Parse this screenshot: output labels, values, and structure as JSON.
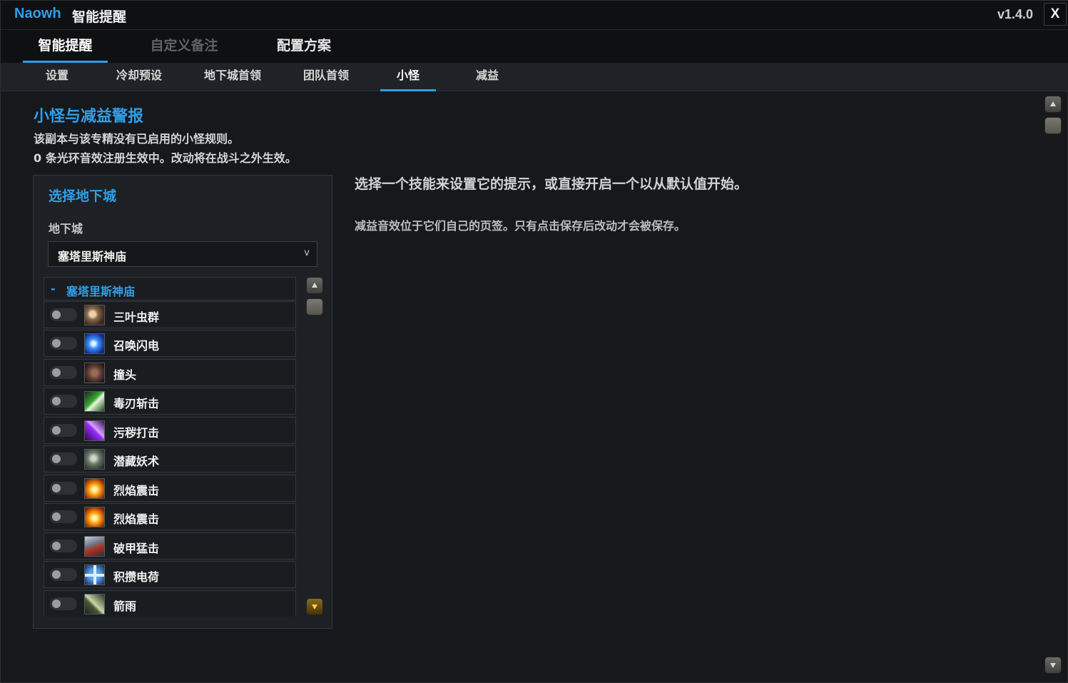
{
  "app": {
    "brand": "Naowh",
    "title": "智能提醒",
    "version": "v1.4.0",
    "close_label": "X"
  },
  "main_tabs": [
    {
      "label": "智能提醒",
      "state": "active"
    },
    {
      "label": "自定义备注",
      "state": "disabled"
    },
    {
      "label": "配置方案",
      "state": "normal"
    }
  ],
  "sub_tabs": [
    {
      "label": "设置"
    },
    {
      "label": "冷却预设"
    },
    {
      "label": "地下城首领"
    },
    {
      "label": "团队首领"
    },
    {
      "label": "小怪",
      "active": true
    },
    {
      "label": "减益"
    }
  ],
  "section": {
    "title": "小怪与减益警报",
    "desc1": "该副本与该专精没有已启用的小怪规则。",
    "desc2": "0 条光环音效注册生效中。改动将在战斗之外生效。"
  },
  "panel": {
    "title": "选择地下城",
    "field_label": "地下城",
    "dropdown_value": "塞塔里斯神庙",
    "dropdown_caret": "v",
    "group_dash": "-",
    "group_label": "塞塔里斯神庙"
  },
  "spells": [
    {
      "name": "三叶虫群",
      "enabled": false,
      "icon": "beetle-swarm-icon"
    },
    {
      "name": "召唤闪电",
      "enabled": false,
      "icon": "lightning-icon"
    },
    {
      "name": "撞头",
      "enabled": false,
      "icon": "headbutt-icon"
    },
    {
      "name": "毒刃斩击",
      "enabled": false,
      "icon": "venom-blade-icon"
    },
    {
      "name": "污秽打击",
      "enabled": false,
      "icon": "defile-strike-icon"
    },
    {
      "name": "潜藏妖术",
      "enabled": false,
      "icon": "hex-icon"
    },
    {
      "name": "烈焰震击",
      "enabled": false,
      "icon": "flame-shock-icon"
    },
    {
      "name": "烈焰震击",
      "enabled": false,
      "icon": "flame-shock-icon"
    },
    {
      "name": "破甲猛击",
      "enabled": false,
      "icon": "sunder-icon"
    },
    {
      "name": "积攒电荷",
      "enabled": false,
      "icon": "static-charge-icon"
    },
    {
      "name": "箭雨",
      "enabled": false,
      "icon": "arrow-volley-icon"
    }
  ],
  "main": {
    "message1": "选择一个技能来设置它的提示，或直接开启一个以从默认值开始。",
    "message2": "减益音效位于它们自己的页签。只有点击保存后改动才会被保存。"
  },
  "colors": {
    "accent": "#2f9fe8",
    "background": "#16181b",
    "panel": "#1d2024"
  }
}
